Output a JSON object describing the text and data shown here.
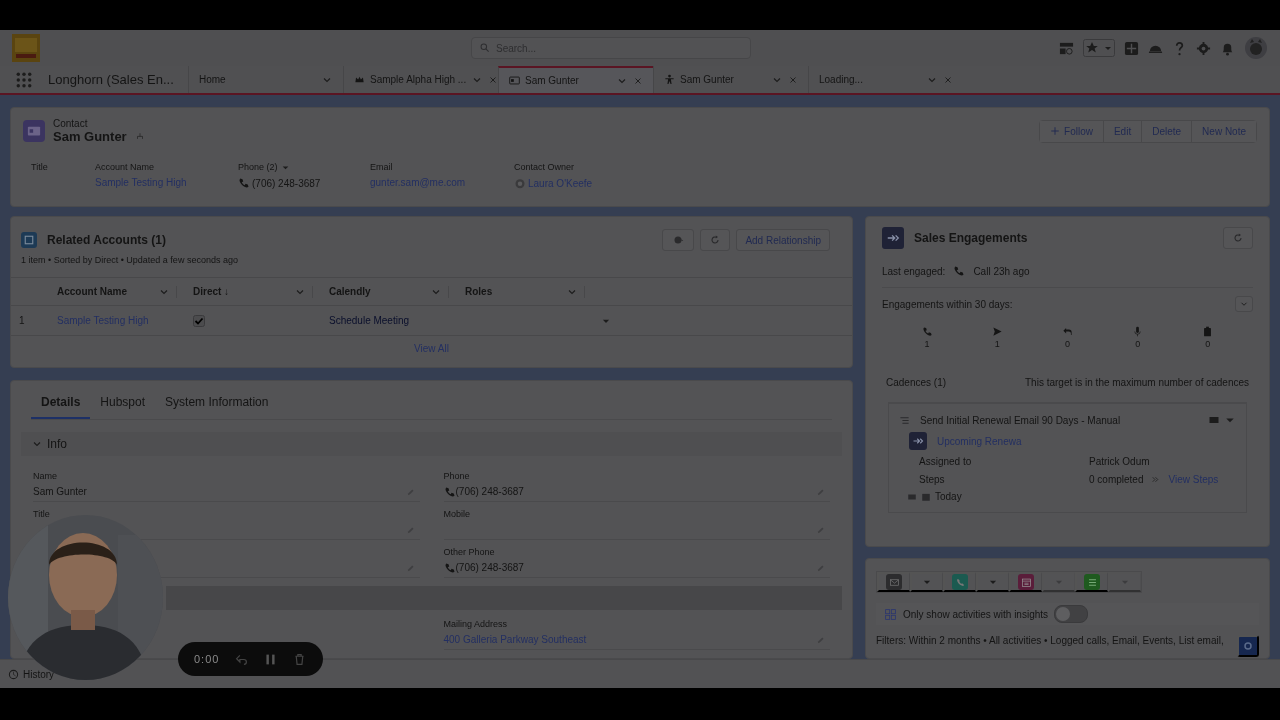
{
  "header": {
    "search_placeholder": "Search..."
  },
  "nav": {
    "app_name": "Longhorn (Sales En...",
    "tabs": [
      {
        "label": "Home",
        "kind": "home",
        "selected": false,
        "closable": false
      },
      {
        "label": "Sample Alpha High ...",
        "kind": "account",
        "selected": false,
        "closable": true
      },
      {
        "label": "Sam Gunter",
        "kind": "contact",
        "selected": true,
        "closable": true
      },
      {
        "label": "Sam Gunter",
        "kind": "person",
        "selected": false,
        "closable": true
      },
      {
        "label": "Loading...",
        "kind": "loading",
        "selected": false,
        "closable": true
      }
    ]
  },
  "record": {
    "object": "Contact",
    "name": "Sam Gunter",
    "actions": [
      {
        "label": "Follow",
        "kind": "follow"
      },
      {
        "label": "Edit",
        "kind": "plain"
      },
      {
        "label": "Delete",
        "kind": "plain"
      },
      {
        "label": "New Note",
        "kind": "plain"
      }
    ],
    "fields": [
      {
        "label": "Title"
      },
      {
        "label": "Account Name",
        "value": "Sample Testing High",
        "kind": "link"
      },
      {
        "label": "Phone (2)",
        "value": "(706) 248-3687",
        "kind": "phone"
      },
      {
        "label": "Email",
        "value": "gunter.sam@me.com",
        "kind": "link"
      },
      {
        "label": "Contact Owner",
        "value": "Laura O'Keefe",
        "kind": "owner"
      }
    ]
  },
  "related_accounts": {
    "title": "Related Accounts (1)",
    "meta": "1 item • Sorted by Direct • Updated a few seconds ago",
    "action": "Add Relationship",
    "columns": [
      "Account Name",
      "Direct ↓",
      "Calendly",
      "Roles"
    ],
    "rows": [
      {
        "number": "1",
        "account": "Sample Testing High",
        "direct": true,
        "calendly": "Schedule Meeting"
      }
    ],
    "view_all": "View All"
  },
  "details": {
    "tabs": [
      {
        "label": "Details",
        "selected": true
      },
      {
        "label": "Hubspot",
        "selected": false
      },
      {
        "label": "System Information",
        "selected": false
      }
    ],
    "section": {
      "title": "Info",
      "expanded": true
    },
    "left_fields": [
      {
        "label": "Name",
        "value": "Sam Gunter"
      },
      {
        "label": "Title"
      }
    ],
    "right_fields": [
      {
        "label": "Phone",
        "value": "(706) 248-3687",
        "kind": "phone"
      },
      {
        "label": "Mobile"
      },
      {
        "label": "Other Phone",
        "value": "(706) 248-3687",
        "kind": "phone"
      }
    ],
    "address_fields": [
      {
        "label": "Mailing Address",
        "value": "400 Galleria Parkway Southeast",
        "kind": "link"
      }
    ]
  },
  "sales_engagements": {
    "title": "Sales Engagements",
    "last_engaged_label": "Last engaged:",
    "last_engaged": "Call 23h ago",
    "engagements_label": "Engagements within 30 days:",
    "counts": [
      {
        "kind": "call",
        "count": "1"
      },
      {
        "kind": "email",
        "count": "1"
      },
      {
        "kind": "reply",
        "count": "0"
      },
      {
        "kind": "meeting",
        "count": "0"
      },
      {
        "kind": "task",
        "count": "0"
      }
    ],
    "cadences_label": "Cadences (1)",
    "cadences_note": "This target is in the maximum number of cadences",
    "cadence": {
      "name": "Send Initial Renewal Email 90 Days - Manual",
      "link": "Upcoming Renewa",
      "assigned_label": "Assigned to",
      "assigned": "Patrick Odum",
      "steps_label": "Steps",
      "steps": "0 completed",
      "view_steps": "View Steps",
      "due": "Today"
    }
  },
  "activity": {
    "buttons": [
      {
        "kind": "email",
        "color": "#2c2c2e",
        "disabled": false
      },
      {
        "kind": "call",
        "color": "#1b5a50",
        "disabled": false
      },
      {
        "kind": "event",
        "color": "#5a1d3a",
        "disabled": true
      },
      {
        "kind": "task",
        "color": "#1f5a1f",
        "disabled": true
      }
    ],
    "insights_label": "Only show activities with insights",
    "insights_on": false,
    "filters": "Filters: Within 2 months • All activities • Logged calls, Email, Events, List email,"
  },
  "utility_bar": {
    "items": [
      "History"
    ]
  },
  "recorder": {
    "time": "0:00"
  }
}
